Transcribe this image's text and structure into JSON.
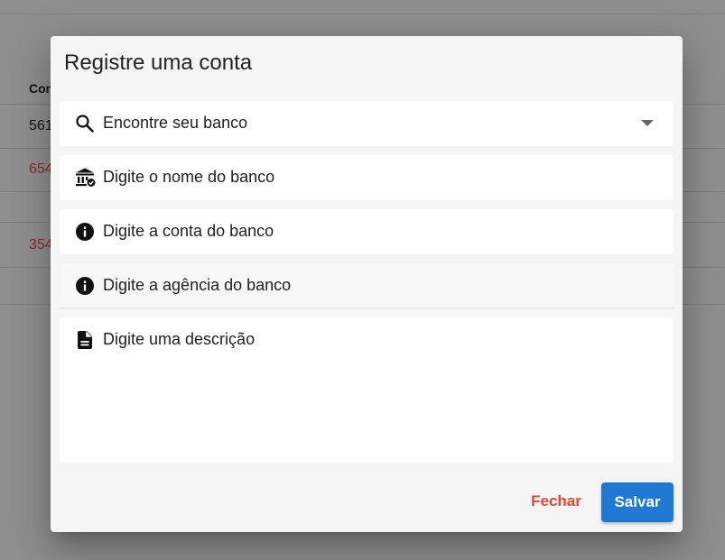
{
  "background": {
    "column_header": "Con",
    "rows": [
      {
        "value": "561",
        "color": "#111111"
      },
      {
        "value": "654",
        "color": "#8e2a22"
      },
      {
        "value": "354",
        "color": "#8e2a22"
      }
    ]
  },
  "dialog": {
    "title": "Registre uma conta",
    "fields": {
      "bank_search": {
        "placeholder": "Encontre seu banco",
        "icon": "search-icon"
      },
      "bank_name": {
        "placeholder": "Digite o nome do banco",
        "icon": "bank-check-icon"
      },
      "bank_account": {
        "placeholder": "Digite a conta do banco",
        "icon": "info-icon"
      },
      "bank_agency": {
        "placeholder": "Digite a agência do banco",
        "icon": "info-icon"
      },
      "description": {
        "placeholder": "Digite uma descrição",
        "icon": "document-icon"
      }
    },
    "buttons": {
      "close_label": "Fechar",
      "save_label": "Salvar"
    },
    "colors": {
      "primary": "#1f78d1",
      "danger": "#e0463b"
    }
  }
}
